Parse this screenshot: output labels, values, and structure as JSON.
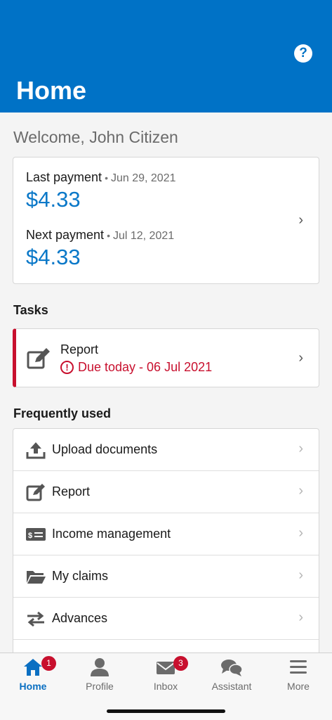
{
  "header": {
    "title": "Home",
    "help_icon": "help-circle-icon",
    "background_color": "#0072c6"
  },
  "welcome": "Welcome, John Citizen",
  "payments": {
    "last": {
      "label": "Last payment",
      "separator": "•",
      "date": "Jun 29, 2021",
      "amount": "$4.33"
    },
    "next": {
      "label": "Next payment",
      "separator": "•",
      "date": "Jul 12, 2021",
      "amount": "$4.33"
    },
    "amount_color": "#0a78c8"
  },
  "tasks": {
    "title": "Tasks",
    "items": [
      {
        "label": "Report",
        "due": "Due today - 06 Jul 2021",
        "icon": "edit-icon",
        "status_color": "#c8102e"
      }
    ]
  },
  "frequently_used": {
    "title": "Frequently used",
    "items": [
      {
        "label": "Upload documents",
        "icon": "upload-icon"
      },
      {
        "label": "Report",
        "icon": "edit-icon"
      },
      {
        "label": "Income management",
        "icon": "money-icon"
      },
      {
        "label": "My claims",
        "icon": "folder-icon"
      },
      {
        "label": "Advances",
        "icon": "swap-icon"
      }
    ]
  },
  "tabbar": {
    "items": [
      {
        "label": "Home",
        "icon": "home-icon",
        "badge": "1",
        "active": true
      },
      {
        "label": "Profile",
        "icon": "person-icon"
      },
      {
        "label": "Inbox",
        "icon": "mail-icon",
        "badge": "3"
      },
      {
        "label": "Assistant",
        "icon": "chat-icon"
      },
      {
        "label": "More",
        "icon": "menu-icon"
      }
    ]
  }
}
